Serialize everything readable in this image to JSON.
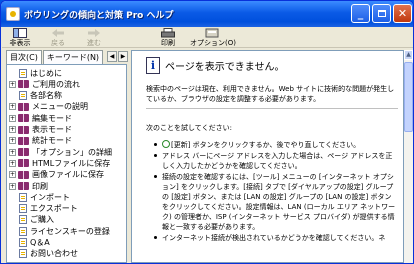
{
  "window": {
    "title": "ボウリングの傾向と対策 Pro ヘルプ"
  },
  "toolbar": {
    "items": [
      {
        "label": "非表示",
        "disabled": false
      },
      {
        "label": "戻る",
        "disabled": true
      },
      {
        "label": "進む",
        "disabled": true
      },
      {
        "label": "印刷",
        "disabled": false
      },
      {
        "label": "オプション(O)",
        "disabled": false
      }
    ]
  },
  "nav": {
    "tab_contents": "目次(C)",
    "tab_index": "キーワード(N)"
  },
  "tree": [
    {
      "label": "はじめに",
      "kind": "page",
      "level": 1,
      "exp": ""
    },
    {
      "label": "ご利用の流れ",
      "kind": "book",
      "level": 0,
      "exp": "+"
    },
    {
      "label": "各部名称",
      "kind": "page",
      "level": 1,
      "exp": ""
    },
    {
      "label": "メニューの説明",
      "kind": "book",
      "level": 0,
      "exp": "+"
    },
    {
      "label": "編集モード",
      "kind": "book",
      "level": 0,
      "exp": "+"
    },
    {
      "label": "表示モード",
      "kind": "book",
      "level": 0,
      "exp": "+"
    },
    {
      "label": "統計モード",
      "kind": "book",
      "level": 0,
      "exp": "+"
    },
    {
      "label": "「オプション」の詳細",
      "kind": "book",
      "level": 0,
      "exp": "+"
    },
    {
      "label": "HTMLファイルに保存",
      "kind": "book",
      "level": 0,
      "exp": "+"
    },
    {
      "label": "画像ファイルに保存",
      "kind": "book",
      "level": 0,
      "exp": "+"
    },
    {
      "label": "印刷",
      "kind": "book",
      "level": 0,
      "exp": "+"
    },
    {
      "label": "インポート",
      "kind": "page",
      "level": 1,
      "exp": ""
    },
    {
      "label": "エクスポート",
      "kind": "page",
      "level": 1,
      "exp": ""
    },
    {
      "label": "ご購入",
      "kind": "page",
      "level": 1,
      "exp": ""
    },
    {
      "label": "ライセンスキーの登録",
      "kind": "page",
      "level": 1,
      "exp": ""
    },
    {
      "label": "Q＆A",
      "kind": "page",
      "level": 1,
      "exp": ""
    },
    {
      "label": "お問い合わせ",
      "kind": "page",
      "level": 1,
      "exp": ""
    }
  ],
  "content": {
    "heading": "ページを表示できません。",
    "para1": "検索中のページは現在、利用できません。Web サイトに技術的な問題が発生しているか、ブラウザの設定を調整する必要があります。",
    "try_label": "次のことを試してください:",
    "bullets": [
      "[更新] ボタンをクリックするか、後でやり直してください。",
      "アドレス バーにページ アドレスを入力した場合は、ページ アドレスを正しく入力したかどうかを確認してください。",
      "接続の設定を確認するには、[ツール] メニューの [インターネット オプション] をクリックします。[接続] タブで [ダイヤルアップの設定] グループの [設定] ボタン、または [LAN の設定] グループの [LAN の設定] ボタンをクリックしてください。設定情報は、LAN (ローカル エリア ネットワーク) の管理者か、ISP (インターネット サービス プロバイダ) が提供する情報と一致する必要があります。",
      "インターネット接続が検出されているかどうかを確認してください。ネ"
    ]
  }
}
